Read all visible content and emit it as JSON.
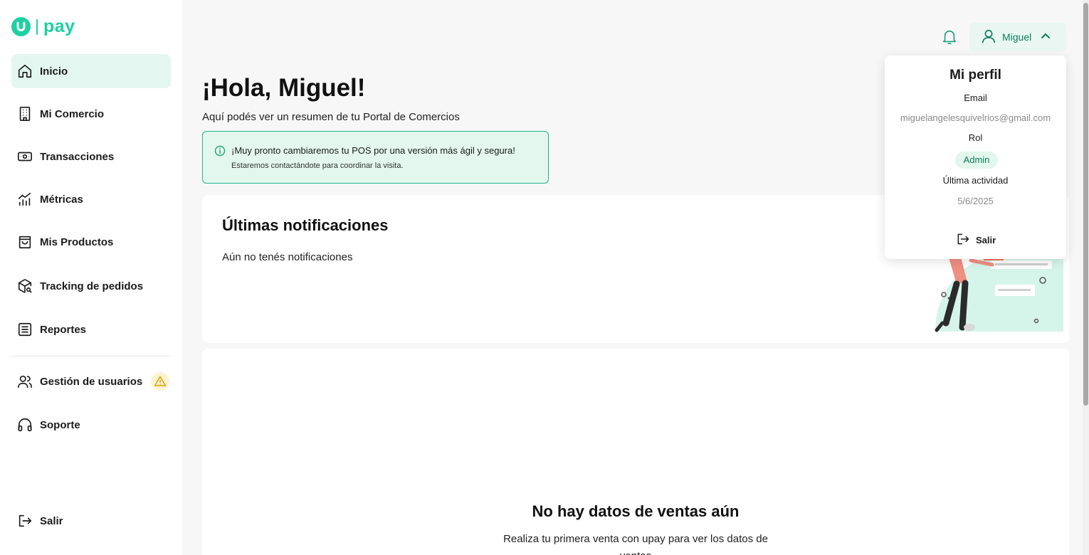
{
  "brand": {
    "logo_text": "pay",
    "accent": "#1dd1a1"
  },
  "sidebar": {
    "items": [
      {
        "label": "Inicio",
        "icon": "home-icon",
        "active": true
      },
      {
        "label": "Mi Comercio",
        "icon": "building-icon"
      },
      {
        "label": "Transacciones",
        "icon": "cash-icon"
      },
      {
        "label": "Métricas",
        "icon": "metrics-icon"
      },
      {
        "label": "Mis Productos",
        "icon": "bag-icon"
      },
      {
        "label": "Tracking de pedidos",
        "icon": "package-search-icon"
      },
      {
        "label": "Reportes",
        "icon": "report-icon"
      },
      {
        "label": "Gestión de usuarios",
        "icon": "users-icon",
        "badge": "warning-icon"
      },
      {
        "label": "Soporte",
        "icon": "headset-icon"
      }
    ],
    "logout_label": "Salir"
  },
  "header": {
    "user_name": "Miguel"
  },
  "main": {
    "greeting": "¡Hola, Miguel!",
    "subtitle": "Aquí podés ver un resumen de tu Portal de Comercios",
    "alert": {
      "title": "¡Muy pronto cambiaremos tu POS por una versión más ágil y segura!",
      "description": "Estaremos contactándote para coordinar la visita."
    },
    "notifications": {
      "title": "Últimas notificaciones",
      "empty": "Aún no tenés notificaciones"
    },
    "sales": {
      "title": "No hay datos de ventas aún",
      "description": "Realiza tu primera venta con upay para ver los datos de ventas"
    }
  },
  "profile": {
    "title": "Mi perfil",
    "email_label": "Email",
    "email": "miguelangelesquivelrios@gmail.com",
    "role_label": "Rol",
    "role": "Admin",
    "activity_label": "Última actividad",
    "activity": "5/6/2025",
    "logout_label": "Salir"
  }
}
